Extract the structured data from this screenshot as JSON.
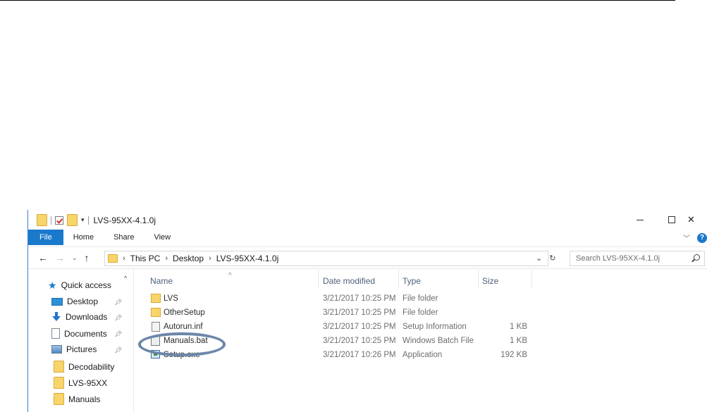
{
  "window": {
    "title": "LVS-95XX-4.1.0j",
    "controls": {
      "minimize": "",
      "maximize": "",
      "close": "✕"
    }
  },
  "ribbon": {
    "tabs": [
      "File",
      "Home",
      "Share",
      "View"
    ],
    "expand_chevron": "﹀",
    "help": "?"
  },
  "address": {
    "nav": {
      "back": "←",
      "forward": "→",
      "recent": "⌄",
      "up": "↑"
    },
    "crumbs": [
      "This PC",
      "Desktop",
      "LVS-95XX-4.1.0j"
    ],
    "dropdown": "⌄",
    "refresh": "↻",
    "search_placeholder": "Search LVS-95XX-4.1.0j"
  },
  "navpane": {
    "quick_access": "Quick access",
    "items": [
      {
        "label": "Desktop",
        "icon": "desktop-icon",
        "pinned": true
      },
      {
        "label": "Downloads",
        "icon": "download-icon",
        "pinned": true
      },
      {
        "label": "Documents",
        "icon": "documents-icon",
        "pinned": true
      },
      {
        "label": "Pictures",
        "icon": "pictures-icon",
        "pinned": true
      },
      {
        "label": "Decodability",
        "icon": "folder-icon",
        "pinned": false
      },
      {
        "label": "LVS-95XX",
        "icon": "folder-icon",
        "pinned": false
      },
      {
        "label": "Manuals",
        "icon": "folder-icon",
        "pinned": false
      }
    ]
  },
  "columns": {
    "name": "Name",
    "date": "Date modified",
    "type": "Type",
    "size": "Size"
  },
  "files": [
    {
      "name": "LVS",
      "date": "3/21/2017 10:25 PM",
      "type": "File folder",
      "size": "",
      "icon": "folder-icon"
    },
    {
      "name": "OtherSetup",
      "date": "3/21/2017 10:25 PM",
      "type": "File folder",
      "size": "",
      "icon": "folder-icon"
    },
    {
      "name": "Autorun.inf",
      "date": "3/21/2017 10:25 PM",
      "type": "Setup Information",
      "size": "1 KB",
      "icon": "setup-info-icon"
    },
    {
      "name": "Manuals.bat",
      "date": "3/21/2017 10:25 PM",
      "type": "Windows Batch File",
      "size": "1 KB",
      "icon": "batch-file-icon"
    },
    {
      "name": "Setup.exe",
      "date": "3/21/2017 10:26 PM",
      "type": "Application",
      "size": "192 KB",
      "icon": "application-icon"
    }
  ],
  "colors": {
    "accent": "#1979ca",
    "highlight_ring": "#6b86a9"
  }
}
